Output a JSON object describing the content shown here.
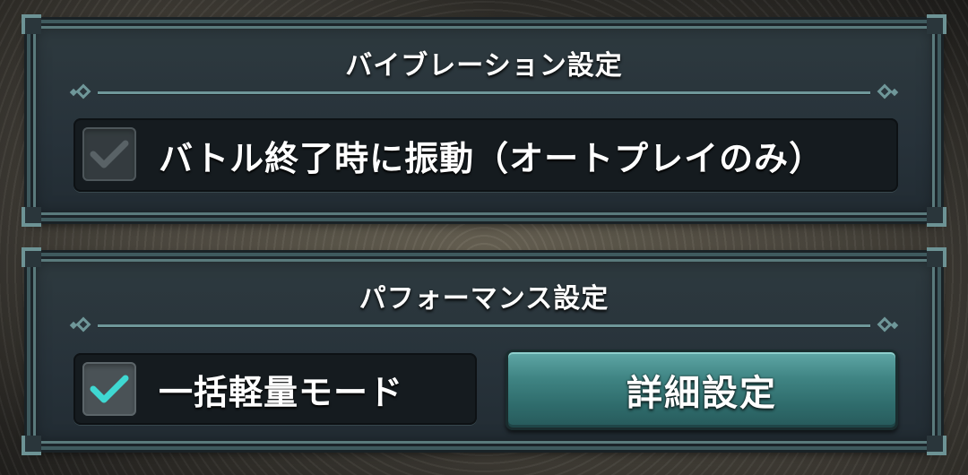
{
  "vibration": {
    "title": "バイブレーション設定",
    "options": [
      {
        "label": "バトル終了時に振動（オートプレイのみ）",
        "checked": true,
        "enabled": false
      }
    ]
  },
  "performance": {
    "title": "パフォーマンス設定",
    "options": [
      {
        "label": "一括軽量モード",
        "checked": true,
        "enabled": true
      }
    ],
    "detail_button_label": "詳細設定"
  },
  "colors": {
    "accent": "#3f8483",
    "check_active": "#3fd8d2",
    "check_disabled": "#6b7478"
  }
}
